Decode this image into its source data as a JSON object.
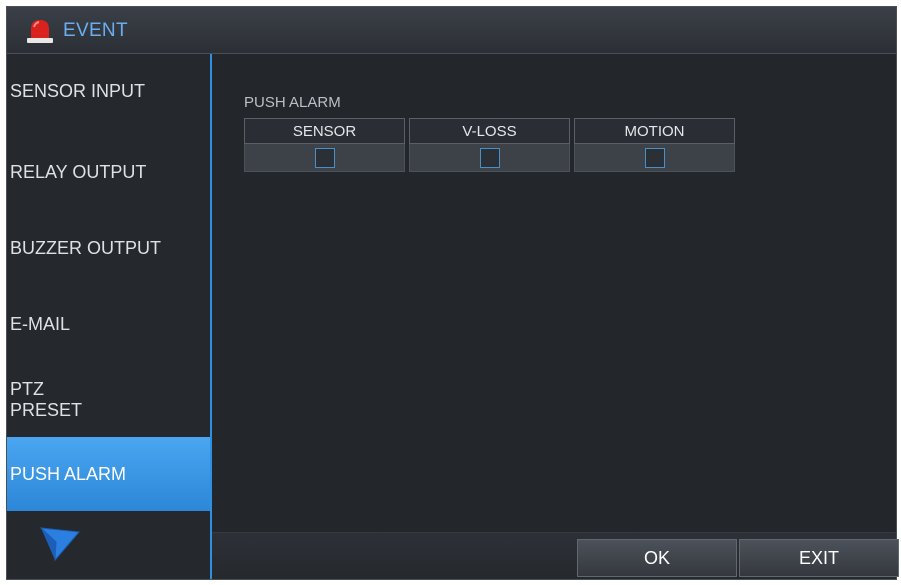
{
  "window": {
    "title": "EVENT",
    "icon": "alarm-siren-icon"
  },
  "sidebar": {
    "items": [
      {
        "label": "SENSOR INPUT",
        "active": false
      },
      {
        "label": "RELAY OUTPUT",
        "active": false
      },
      {
        "label": "BUZZER OUTPUT",
        "active": false
      },
      {
        "label": "E-MAIL",
        "active": false
      },
      {
        "label": "PTZ\nPRESET",
        "active": false
      },
      {
        "label": "PUSH ALARM",
        "active": true
      }
    ]
  },
  "content": {
    "section_title": "PUSH ALARM",
    "columns": [
      {
        "header": "SENSOR",
        "checked": false
      },
      {
        "header": "V-LOSS",
        "checked": false
      },
      {
        "header": "MOTION",
        "checked": false
      }
    ]
  },
  "buttons": {
    "ok": "OK",
    "exit": "EXIT"
  },
  "colors": {
    "accent": "#2f8fe0",
    "title": "#6aaef0",
    "background": "#23262b"
  }
}
